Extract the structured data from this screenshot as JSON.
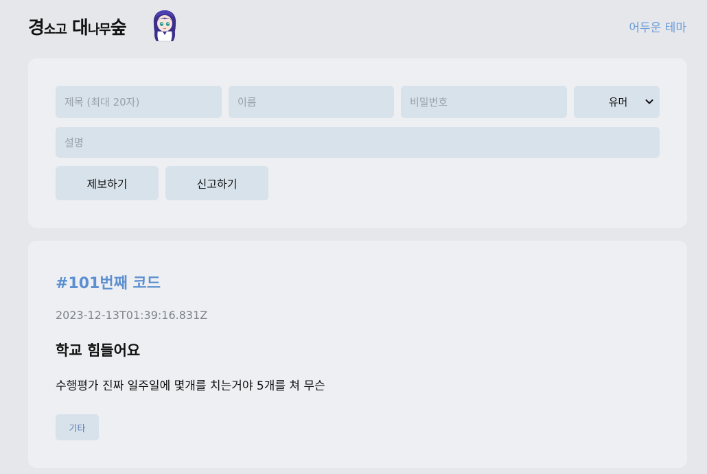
{
  "header": {
    "logo": {
      "part1_big": "경",
      "part1_small": "소고",
      "part2_big": "대",
      "part2_small": "나무",
      "part2_end": "숲"
    },
    "theme_toggle": "어두운 테마"
  },
  "form": {
    "title_placeholder": "제목 (최대 20자)",
    "name_placeholder": "이름",
    "password_placeholder": "비밀번호",
    "category_selected": "유머",
    "description_placeholder": "설명",
    "submit_label": "제보하기",
    "report_label": "신고하기"
  },
  "posts": [
    {
      "id_label": "#101번째 코드",
      "timestamp": "2023-12-13T01:39:16.831Z",
      "title": "학교 힘들어요",
      "body": "수행평가 진짜 일주일에 몇개를 치는거야 5개를 쳐 무슨",
      "tag": "기타"
    }
  ],
  "colors": {
    "background": "#e5e7eb",
    "card": "#edeff2",
    "field": "#d8e2ea",
    "accent": "#5c8fd1"
  },
  "icons": {
    "mascot": "anime-girl-mascot-icon",
    "select_chevron": "chevron-down-icon"
  }
}
